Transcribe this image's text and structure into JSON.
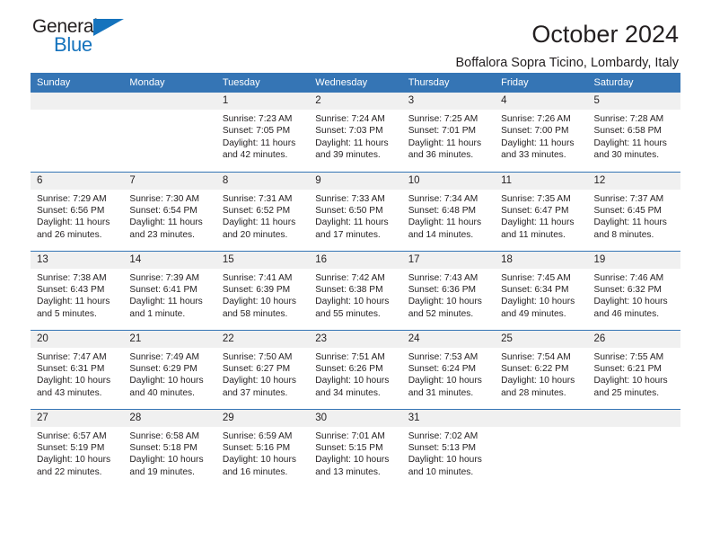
{
  "brand": {
    "name_part1": "General",
    "name_part2": "Blue",
    "accent_color": "#1573bd",
    "triangle_icon": "triangle-icon"
  },
  "header": {
    "month_year": "October 2024",
    "location": "Boffalora Sopra Ticino, Lombardy, Italy",
    "header_bg_color": "#3575b5",
    "daynum_bg_color": "#f0f0f0"
  },
  "weekday_headers": [
    "Sunday",
    "Monday",
    "Tuesday",
    "Wednesday",
    "Thursday",
    "Friday",
    "Saturday"
  ],
  "weeks": [
    [
      {
        "day": "",
        "sunrise": "",
        "sunset": "",
        "daylight": "",
        "empty": true
      },
      {
        "day": "",
        "sunrise": "",
        "sunset": "",
        "daylight": "",
        "empty": true
      },
      {
        "day": "1",
        "sunrise": "Sunrise: 7:23 AM",
        "sunset": "Sunset: 7:05 PM",
        "daylight": "Daylight: 11 hours and 42 minutes."
      },
      {
        "day": "2",
        "sunrise": "Sunrise: 7:24 AM",
        "sunset": "Sunset: 7:03 PM",
        "daylight": "Daylight: 11 hours and 39 minutes."
      },
      {
        "day": "3",
        "sunrise": "Sunrise: 7:25 AM",
        "sunset": "Sunset: 7:01 PM",
        "daylight": "Daylight: 11 hours and 36 minutes."
      },
      {
        "day": "4",
        "sunrise": "Sunrise: 7:26 AM",
        "sunset": "Sunset: 7:00 PM",
        "daylight": "Daylight: 11 hours and 33 minutes."
      },
      {
        "day": "5",
        "sunrise": "Sunrise: 7:28 AM",
        "sunset": "Sunset: 6:58 PM",
        "daylight": "Daylight: 11 hours and 30 minutes."
      }
    ],
    [
      {
        "day": "6",
        "sunrise": "Sunrise: 7:29 AM",
        "sunset": "Sunset: 6:56 PM",
        "daylight": "Daylight: 11 hours and 26 minutes."
      },
      {
        "day": "7",
        "sunrise": "Sunrise: 7:30 AM",
        "sunset": "Sunset: 6:54 PM",
        "daylight": "Daylight: 11 hours and 23 minutes."
      },
      {
        "day": "8",
        "sunrise": "Sunrise: 7:31 AM",
        "sunset": "Sunset: 6:52 PM",
        "daylight": "Daylight: 11 hours and 20 minutes."
      },
      {
        "day": "9",
        "sunrise": "Sunrise: 7:33 AM",
        "sunset": "Sunset: 6:50 PM",
        "daylight": "Daylight: 11 hours and 17 minutes."
      },
      {
        "day": "10",
        "sunrise": "Sunrise: 7:34 AM",
        "sunset": "Sunset: 6:48 PM",
        "daylight": "Daylight: 11 hours and 14 minutes."
      },
      {
        "day": "11",
        "sunrise": "Sunrise: 7:35 AM",
        "sunset": "Sunset: 6:47 PM",
        "daylight": "Daylight: 11 hours and 11 minutes."
      },
      {
        "day": "12",
        "sunrise": "Sunrise: 7:37 AM",
        "sunset": "Sunset: 6:45 PM",
        "daylight": "Daylight: 11 hours and 8 minutes."
      }
    ],
    [
      {
        "day": "13",
        "sunrise": "Sunrise: 7:38 AM",
        "sunset": "Sunset: 6:43 PM",
        "daylight": "Daylight: 11 hours and 5 minutes."
      },
      {
        "day": "14",
        "sunrise": "Sunrise: 7:39 AM",
        "sunset": "Sunset: 6:41 PM",
        "daylight": "Daylight: 11 hours and 1 minute."
      },
      {
        "day": "15",
        "sunrise": "Sunrise: 7:41 AM",
        "sunset": "Sunset: 6:39 PM",
        "daylight": "Daylight: 10 hours and 58 minutes."
      },
      {
        "day": "16",
        "sunrise": "Sunrise: 7:42 AM",
        "sunset": "Sunset: 6:38 PM",
        "daylight": "Daylight: 10 hours and 55 minutes."
      },
      {
        "day": "17",
        "sunrise": "Sunrise: 7:43 AM",
        "sunset": "Sunset: 6:36 PM",
        "daylight": "Daylight: 10 hours and 52 minutes."
      },
      {
        "day": "18",
        "sunrise": "Sunrise: 7:45 AM",
        "sunset": "Sunset: 6:34 PM",
        "daylight": "Daylight: 10 hours and 49 minutes."
      },
      {
        "day": "19",
        "sunrise": "Sunrise: 7:46 AM",
        "sunset": "Sunset: 6:32 PM",
        "daylight": "Daylight: 10 hours and 46 minutes."
      }
    ],
    [
      {
        "day": "20",
        "sunrise": "Sunrise: 7:47 AM",
        "sunset": "Sunset: 6:31 PM",
        "daylight": "Daylight: 10 hours and 43 minutes."
      },
      {
        "day": "21",
        "sunrise": "Sunrise: 7:49 AM",
        "sunset": "Sunset: 6:29 PM",
        "daylight": "Daylight: 10 hours and 40 minutes."
      },
      {
        "day": "22",
        "sunrise": "Sunrise: 7:50 AM",
        "sunset": "Sunset: 6:27 PM",
        "daylight": "Daylight: 10 hours and 37 minutes."
      },
      {
        "day": "23",
        "sunrise": "Sunrise: 7:51 AM",
        "sunset": "Sunset: 6:26 PM",
        "daylight": "Daylight: 10 hours and 34 minutes."
      },
      {
        "day": "24",
        "sunrise": "Sunrise: 7:53 AM",
        "sunset": "Sunset: 6:24 PM",
        "daylight": "Daylight: 10 hours and 31 minutes."
      },
      {
        "day": "25",
        "sunrise": "Sunrise: 7:54 AM",
        "sunset": "Sunset: 6:22 PM",
        "daylight": "Daylight: 10 hours and 28 minutes."
      },
      {
        "day": "26",
        "sunrise": "Sunrise: 7:55 AM",
        "sunset": "Sunset: 6:21 PM",
        "daylight": "Daylight: 10 hours and 25 minutes."
      }
    ],
    [
      {
        "day": "27",
        "sunrise": "Sunrise: 6:57 AM",
        "sunset": "Sunset: 5:19 PM",
        "daylight": "Daylight: 10 hours and 22 minutes."
      },
      {
        "day": "28",
        "sunrise": "Sunrise: 6:58 AM",
        "sunset": "Sunset: 5:18 PM",
        "daylight": "Daylight: 10 hours and 19 minutes."
      },
      {
        "day": "29",
        "sunrise": "Sunrise: 6:59 AM",
        "sunset": "Sunset: 5:16 PM",
        "daylight": "Daylight: 10 hours and 16 minutes."
      },
      {
        "day": "30",
        "sunrise": "Sunrise: 7:01 AM",
        "sunset": "Sunset: 5:15 PM",
        "daylight": "Daylight: 10 hours and 13 minutes."
      },
      {
        "day": "31",
        "sunrise": "Sunrise: 7:02 AM",
        "sunset": "Sunset: 5:13 PM",
        "daylight": "Daylight: 10 hours and 10 minutes."
      },
      {
        "day": "",
        "sunrise": "",
        "sunset": "",
        "daylight": "",
        "empty": true
      },
      {
        "day": "",
        "sunrise": "",
        "sunset": "",
        "daylight": "",
        "empty": true
      }
    ]
  ]
}
